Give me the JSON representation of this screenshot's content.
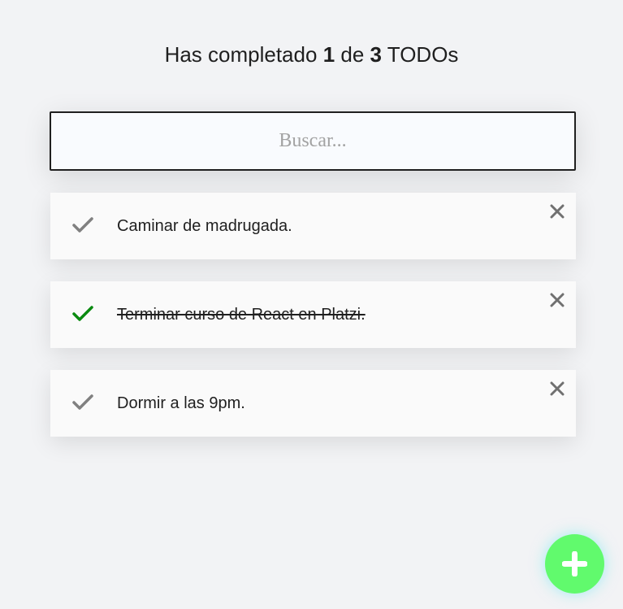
{
  "counter": {
    "prefix": "Has completado",
    "completed": "1",
    "middle": "de",
    "total": "3",
    "suffix": "TODOs"
  },
  "search": {
    "placeholder": "Buscar...",
    "value": ""
  },
  "todos": [
    {
      "text": "Caminar de madrugada.",
      "completed": false
    },
    {
      "text": "Terminar curso de React en Platzi.",
      "completed": true
    },
    {
      "text": "Dormir a las 9pm.",
      "completed": false
    }
  ],
  "icons": {
    "check": "check-icon",
    "delete": "close-icon",
    "add": "plus-icon"
  },
  "colors": {
    "background": "#f2f3f5",
    "check_done": "#0a8a10",
    "check_pending": "#808080",
    "delete_icon": "#707070",
    "add_button": "#61fa6d",
    "add_icon": "#ffffff"
  }
}
